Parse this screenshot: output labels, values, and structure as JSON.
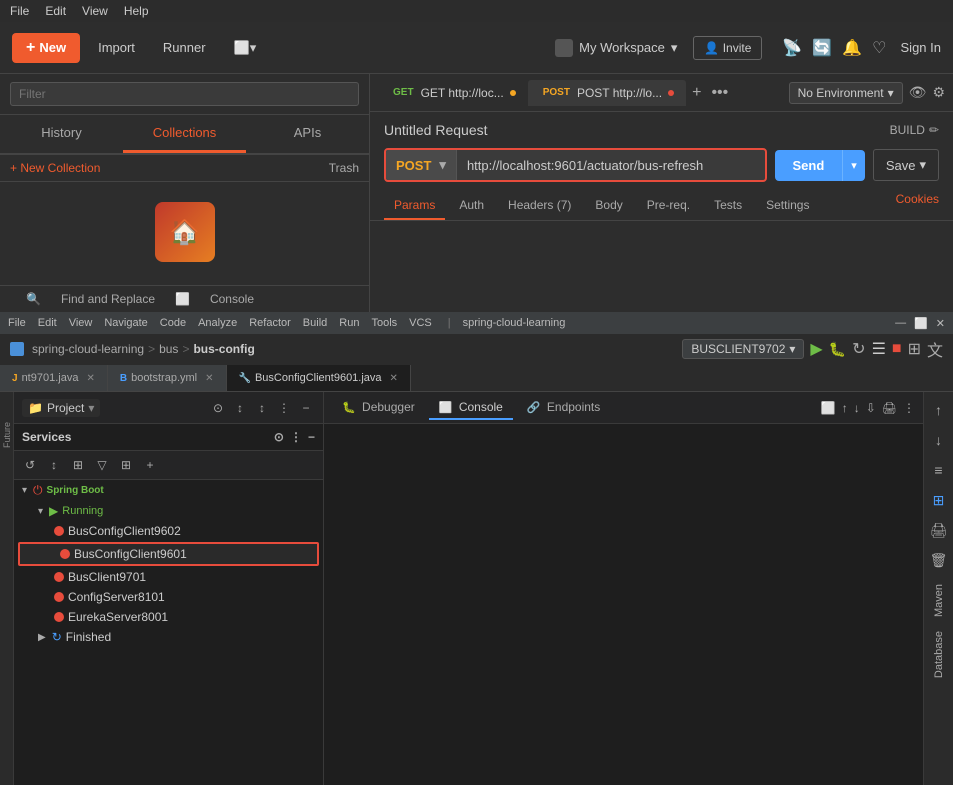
{
  "menubar": {
    "items": [
      "File",
      "Edit",
      "View",
      "Help"
    ]
  },
  "postman": {
    "header": {
      "new_label": "New",
      "import_label": "Import",
      "runner_label": "Runner",
      "workspace": "My Workspace",
      "invite": "Invite",
      "sign_in": "Sign In"
    },
    "sidebar": {
      "search_placeholder": "Filter",
      "tabs": {
        "history": "History",
        "collections": "Collections",
        "apis": "APIs"
      },
      "new_collection": "+ New Collection",
      "trash": "Trash",
      "find_replace": "Find and Replace",
      "console": "Console"
    },
    "request": {
      "title": "Untitled Request",
      "build": "BUILD",
      "method": "POST",
      "url": "http://localhost:9601/actuator/bus-refresh",
      "send": "Send",
      "save": "Save",
      "tabs": {
        "params": "Params",
        "auth": "Auth",
        "headers": "Headers (7)",
        "body": "Body",
        "prereq": "Pre-req.",
        "tests": "Tests",
        "settings": "Settings",
        "cookies": "Cookies"
      }
    },
    "tabs": {
      "get_tab": "GET http://loc...",
      "post_tab": "POST http://lo..."
    }
  },
  "ide": {
    "menubar": [
      "File",
      "Edit",
      "View",
      "Navigate",
      "Code",
      "Analyze",
      "Refactor",
      "Build",
      "Run",
      "Tools",
      "VCS",
      "spring-cloud-learnin"
    ],
    "breadcrumb": {
      "project": "spring-cloud-learning",
      "sep1": ">",
      "module": "bus",
      "sep2": ">",
      "current": "bus-config"
    },
    "run_config": "BUSCLIENT9702",
    "file_tabs": [
      {
        "name": "nt9701.java",
        "type": "java",
        "active": false
      },
      {
        "name": "bootstrap.yml",
        "type": "yml",
        "active": false
      },
      {
        "name": "BusConfigClient9601.java",
        "type": "java",
        "active": true
      }
    ],
    "project_label": "Project",
    "services_label": "Services",
    "tree": {
      "spring_boot": "Spring Boot",
      "running": "Running",
      "services": [
        {
          "name": "BusConfigClient9602",
          "selected": false
        },
        {
          "name": "BusConfigClient9601",
          "selected": true
        },
        {
          "name": "BusClient9701",
          "selected": false
        },
        {
          "name": "ConfigServer8101",
          "selected": false
        },
        {
          "name": "EurekaServer8001",
          "selected": false
        }
      ],
      "finished": "Finished"
    },
    "console_tabs": [
      "Debugger",
      "Console",
      "Endpoints"
    ],
    "maven_label": "Maven",
    "database_label": "Database",
    "future_label": "Future"
  }
}
